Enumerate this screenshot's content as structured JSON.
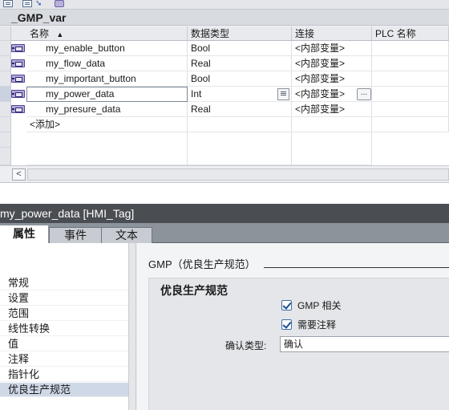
{
  "table": {
    "title": "_GMP_var",
    "columns": [
      "名称",
      "数据类型",
      "连接",
      "PLC 名称"
    ],
    "sort_indicator": "▲",
    "rows": [
      {
        "name": "my_enable_button",
        "type": "Bool",
        "connection": "<内部变量>"
      },
      {
        "name": "my_flow_data",
        "type": "Real",
        "connection": "<内部变量>"
      },
      {
        "name": "my_important_button",
        "type": "Bool",
        "connection": "<内部变量>"
      },
      {
        "name": "my_power_data",
        "type": "Int",
        "connection": "<内部变量>"
      },
      {
        "name": "my_presure_data",
        "type": "Real",
        "connection": "<内部变量>"
      }
    ],
    "add_label": "<添加>",
    "ellipsis": "...",
    "scroll_left": "<"
  },
  "inspector": {
    "title": "my_power_data [HMI_Tag]",
    "tabs": [
      "属性",
      "事件",
      "文本"
    ],
    "active_tab": "属性",
    "nav": [
      "常规",
      "设置",
      "范围",
      "线性转换",
      "值",
      "注释",
      "指针化",
      "优良生产规范"
    ],
    "selected_nav": "优良生产规范",
    "section_header": "GMP（优良生产规范）",
    "group_title": "优良生产规范",
    "gmp_related_label": "GMP 相关",
    "gmp_related_checked": true,
    "needs_comment_label": "需要注释",
    "needs_comment_checked": true,
    "confirm_type_label": "确认类型:",
    "confirm_type_value": "确认"
  },
  "icons": [
    "tag-icon",
    "document-icon",
    "arrow-icon",
    "list-icon",
    "checkbox-icon"
  ],
  "colors": {
    "header_bg": "#d8dbe0",
    "inspector_title_bg": "#4a4d52",
    "tab_bar_bg": "#8c939b",
    "selection": "#cfd8e6",
    "checkbox": "#1d4f8a"
  }
}
